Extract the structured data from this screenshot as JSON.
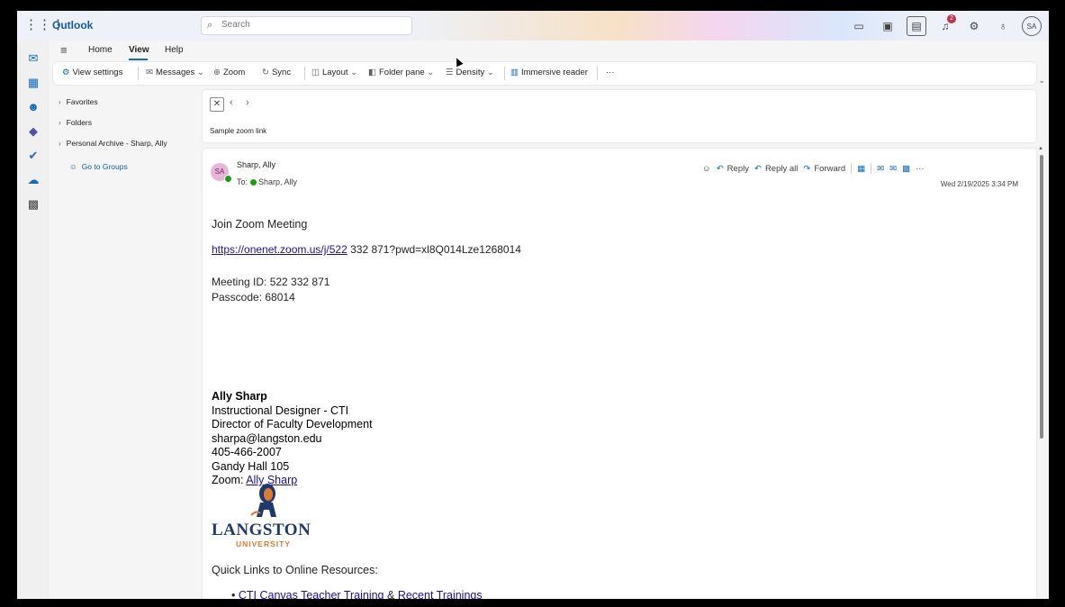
{
  "app": {
    "name": "Outlook"
  },
  "search": {
    "placeholder": "Search"
  },
  "ribbon": {
    "tabs": [
      "Home",
      "View",
      "Help"
    ],
    "buttons": {
      "view_settings": "View settings",
      "messages": "Messages",
      "zoom": "Zoom",
      "sync": "Sync",
      "layout": "Layout",
      "folder_pane": "Folder pane",
      "density": "Density",
      "immersive_reader": "Immersive reader",
      "more": "···"
    }
  },
  "topbar": {
    "notification_count": "2",
    "avatar_initials": "SA"
  },
  "folders": {
    "favorites": "Favorites",
    "folders": "Folders",
    "archive": "Personal Archive - Sharp, Ally",
    "groups": "Go to Groups"
  },
  "thread": {
    "subject": "Sample zoom link"
  },
  "message": {
    "sender_initials": "SA",
    "sender": "Sharp, Ally",
    "to_label": "To:",
    "to": "Sharp, Ally",
    "actions": {
      "reply": "Reply",
      "reply_all": "Reply all",
      "forward": "Forward",
      "more": "···"
    },
    "date": "Wed 2/19/2025 3:34 PM",
    "body": {
      "join": "Join Zoom Meeting",
      "link_part": "https://onenet.zoom.us/j/522",
      "link_rest": " 332 871?pwd=xl8Q014Lze1268014",
      "meeting_id": "Meeting ID: 522 332 871",
      "passcode": "Passcode: 68014"
    },
    "signature": {
      "name": "Ally Sharp",
      "title1": "Instructional Designer - CTI",
      "title2": "Director of Faculty Development",
      "email": "sharpa@langston.edu",
      "phone": "405-466-2007",
      "office": "Gandy Hall 105",
      "zoom_label": "Zoom: ",
      "zoom_link": "Ally Sharp",
      "logo_name": "LANGSTON",
      "logo_sub": "UNIVERSITY"
    },
    "quick_links_title": "Quick Links to Online Resources:",
    "quick_links": {
      "item1": "CTI Canvas Teacher Training",
      "sep": " & ",
      "item2": "Recent Trainings"
    }
  }
}
